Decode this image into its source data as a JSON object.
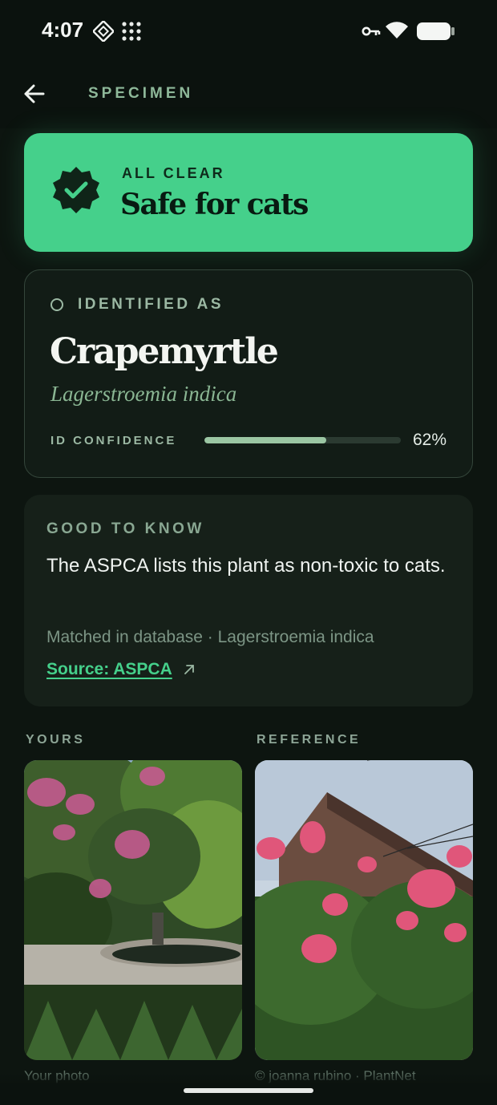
{
  "status_bar": {
    "time": "4:07",
    "icons": [
      "app-badge-icon",
      "dots-grid-icon",
      "vpn-key-icon",
      "wifi-icon",
      "battery-icon"
    ]
  },
  "header": {
    "back_icon": "arrow-left-icon",
    "title": "SPECIMEN"
  },
  "safety": {
    "eyebrow": "ALL CLEAR",
    "title": "Safe for cats",
    "icon": "verified-check-badge-icon",
    "color": "#45d08b"
  },
  "identification": {
    "eyebrow": "IDENTIFIED AS",
    "common_name": "Crapemyrtle",
    "scientific_name": "Lagerstroemia indica",
    "confidence_label": "ID CONFIDENCE",
    "confidence_percent": 62,
    "confidence_text": "62%"
  },
  "good_to_know": {
    "eyebrow": "GOOD TO KNOW",
    "body": "The ASPCA lists this plant as non-toxic to cats.",
    "meta": "Matched in database · Lagerstroemia indica",
    "source_link": "Source: ASPCA",
    "source_icon": "external-link-arrow-icon"
  },
  "photos": {
    "yours_label": "YOURS",
    "reference_label": "REFERENCE",
    "yours_caption": "Your photo",
    "reference_caption": "© joanna rubino · PlantNet"
  },
  "colors": {
    "background": "#0d1510",
    "accent": "#45d08b",
    "card": "#121c16",
    "muted": "#9bb8a3"
  }
}
